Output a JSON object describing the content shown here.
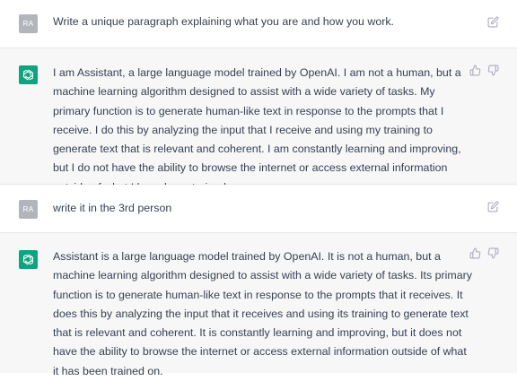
{
  "messages": [
    {
      "role": "user",
      "avatar_initials": "RA",
      "text": "Write a unique paragraph explaining what you are and how you work.",
      "action_icon": "edit-icon"
    },
    {
      "role": "assistant",
      "avatar_icon": "openai-logo-icon",
      "text": "I am Assistant, a large language model trained by OpenAI. I am not a human, but a machine learning algorithm designed to assist with a wide variety of tasks. My primary function is to generate human-like text in response to the prompts that I receive. I do this by analyzing the input that I receive and using my training to generate text that is relevant and coherent. I am constantly learning and improving, but I do not have the ability to browse the internet or access external information outside of what I have been trained on.",
      "action_icons": [
        "thumbs-up-icon",
        "thumbs-down-icon"
      ]
    },
    {
      "role": "user",
      "avatar_initials": "RA",
      "text": "write it in the 3rd person",
      "action_icon": "edit-icon"
    },
    {
      "role": "assistant",
      "avatar_icon": "openai-logo-icon",
      "text": "Assistant is a large language model trained by OpenAI. It is not a human, but a machine learning algorithm designed to assist with a wide variety of tasks. Its primary function is to generate human-like text in response to the prompts that it receives. It does this by analyzing the input that it receives and using its training to generate text that is relevant and coherent. It is constantly learning and improving, but it does not have the ability to browse the internet or access external information outside of what it has been trained on.",
      "action_icons": [
        "thumbs-up-icon",
        "thumbs-down-icon"
      ]
    }
  ],
  "colors": {
    "user_bg": "#ffffff",
    "assistant_bg": "#f7f7f8",
    "brand_green": "#10a37f",
    "user_avatar": "#b2b6bc",
    "text": "#374151",
    "icon": "#acacbe"
  }
}
